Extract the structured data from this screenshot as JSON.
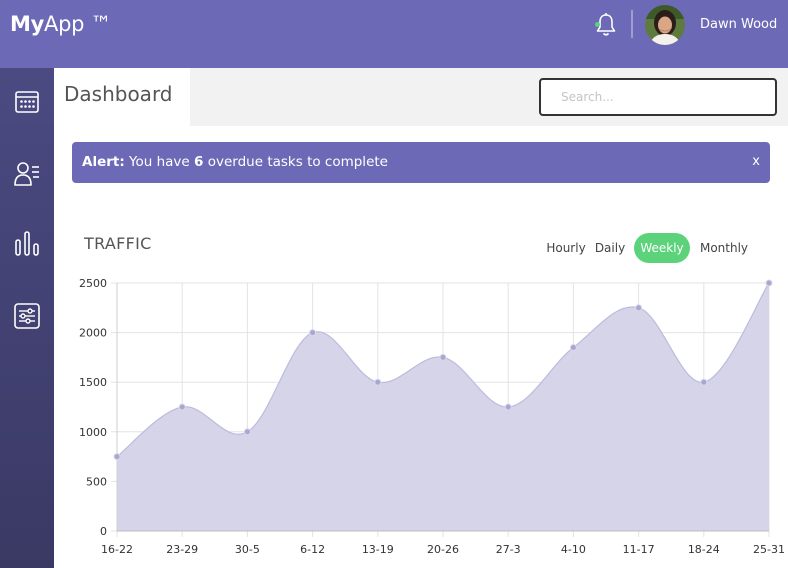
{
  "header": {
    "logo_bold": "My",
    "logo_rest": "App ™",
    "user_name": "Dawn Wood",
    "notification_icon": "bell-icon",
    "status_color": "#5cd27a",
    "brand_color": "#6c6ab7"
  },
  "sidebar": {
    "items": [
      {
        "icon": "calendar-icon"
      },
      {
        "icon": "contacts-list-icon"
      },
      {
        "icon": "bar-chart-icon"
      },
      {
        "icon": "settings-sliders-icon"
      }
    ]
  },
  "page": {
    "title": "Dashboard",
    "search_placeholder": "Search..."
  },
  "alert": {
    "label": "Alert:",
    "text_before": "You have",
    "count": "6",
    "text_after": "overdue tasks to complete",
    "close": "x"
  },
  "chart_panel": {
    "title": "TRAFFIC",
    "ranges": [
      "Hourly",
      "Daily",
      "Weekly",
      "Monthly"
    ],
    "active_range": "Weekly"
  },
  "chart_data": {
    "type": "area",
    "categories": [
      "16-22",
      "23-29",
      "30-5",
      "6-12",
      "13-19",
      "20-26",
      "27-3",
      "4-10",
      "11-17",
      "18-24",
      "25-31"
    ],
    "series": [
      {
        "values": [
          750,
          1250,
          1000,
          2000,
          1500,
          1750,
          1250,
          1850,
          2250,
          1500,
          2500
        ]
      }
    ],
    "ylim": [
      0,
      2500
    ],
    "yticks": [
      0,
      500,
      1000,
      1500,
      2000,
      2500
    ],
    "grid": true,
    "fill_color": "#d3d2e8",
    "line_color": "#bdbbdb",
    "point_color": "#a9a7d0"
  }
}
